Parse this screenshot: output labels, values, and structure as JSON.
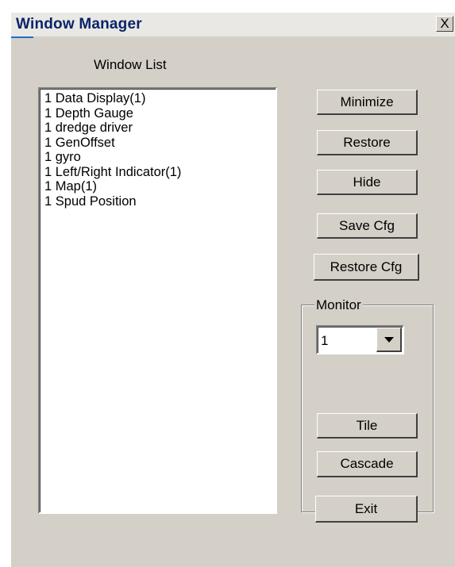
{
  "window": {
    "title": "Window Manager",
    "close_label": "X"
  },
  "window_list": {
    "label": "Window List",
    "items": [
      "1 Data Display(1)",
      "1 Depth Gauge",
      "1 dredge driver",
      "1 GenOffset",
      "1 gyro",
      "1 Left/Right Indicator(1)",
      "1 Map(1)",
      "1 Spud Position"
    ]
  },
  "buttons": {
    "minimize": "Minimize",
    "restore": "Restore",
    "hide": "Hide",
    "save_cfg": "Save Cfg",
    "restore_cfg": "Restore Cfg",
    "tile": "Tile",
    "cascade": "Cascade",
    "exit": "Exit"
  },
  "monitor": {
    "label": "Monitor",
    "selected": "1"
  },
  "icons": {
    "close": "close-icon",
    "dropdown": "chevron-down-icon"
  }
}
